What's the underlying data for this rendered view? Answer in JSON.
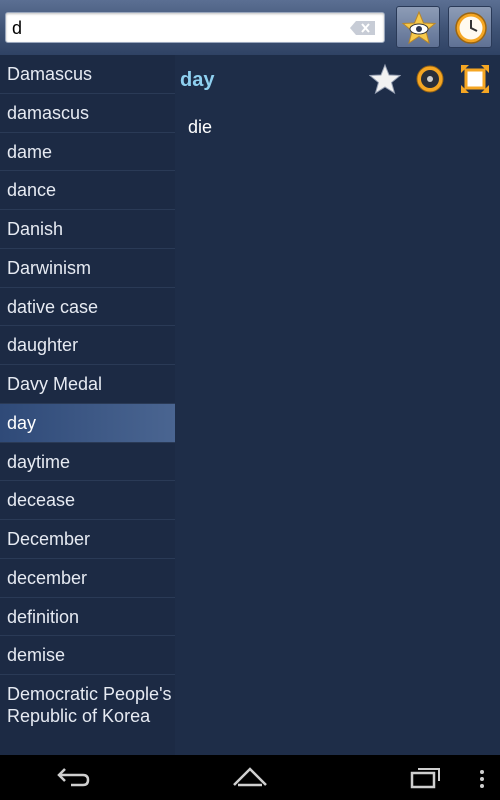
{
  "search": {
    "value": "d",
    "placeholder": ""
  },
  "toolbar": {
    "favorites_icon": "star-eye-icon",
    "history_icon": "clock-icon"
  },
  "word_list": {
    "items": [
      {
        "label": "Damascus"
      },
      {
        "label": "damascus"
      },
      {
        "label": "dame"
      },
      {
        "label": "dance"
      },
      {
        "label": "Danish"
      },
      {
        "label": "Darwinism"
      },
      {
        "label": "dative case"
      },
      {
        "label": "daughter"
      },
      {
        "label": "Davy Medal"
      },
      {
        "label": "day"
      },
      {
        "label": "daytime"
      },
      {
        "label": "decease"
      },
      {
        "label": "December"
      },
      {
        "label": "december"
      },
      {
        "label": "definition"
      },
      {
        "label": "demise"
      },
      {
        "label": "Democratic People's Republic of Korea"
      }
    ],
    "selected_index": 9
  },
  "detail": {
    "headword": "day",
    "translation": "die",
    "icons": [
      "star-icon",
      "speaker-icon",
      "fullscreen-icon"
    ]
  },
  "navbar": {
    "icons": [
      "back-icon",
      "home-icon",
      "recent-apps-icon",
      "menu-icon"
    ]
  },
  "colors": {
    "background": "#1c2a44",
    "headword": "#8fd0f0",
    "selected": "#4a6591",
    "accent_orange": "#f5a623"
  }
}
